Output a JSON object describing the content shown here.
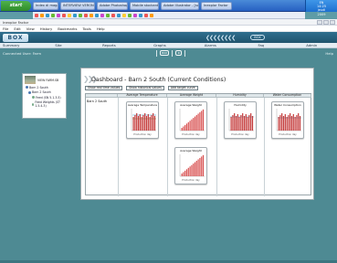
{
  "taskbar": {
    "start_label": "start",
    "tasks": [
      "Index di magazine",
      "INTERVIEW VERONE...",
      "Adobe Photoshop",
      "Mobile stockant",
      "Adobe Illustrator - [scr...",
      "Inexplor Factor"
    ],
    "tray_lines": [
      "EN",
      "14:25",
      "jeudi",
      "2009"
    ]
  },
  "browser": {
    "window_title": "Inexplor Factor",
    "menus": [
      "File",
      "Edit",
      "View",
      "History",
      "Bookmarks",
      "Tools",
      "Help"
    ]
  },
  "app": {
    "logo": "BOX",
    "header_pill": "BOX",
    "nav": [
      "Summary",
      "Site",
      "Reports",
      "Graphs",
      "Alarms",
      "Faq",
      "Admin"
    ],
    "login_text": "Connected User: Farm",
    "help_label": "Help",
    "toolbar": [
      "BOX",
      "⚙"
    ]
  },
  "tree": {
    "site_name": "VIEW FARM.SB",
    "nodes": [
      "Barn 2 South",
      "Barn 2 South",
      "Feed (SN 5.1.3.5)",
      "Feed Weights (ST 1.5.4.3)"
    ]
  },
  "dashboard": {
    "title": "Dashboard - Barn 2 South (Current Conditions)",
    "buttons": [
      "Show real time values",
      "Show historical values",
      "Add target curve"
    ],
    "columns": [
      "Average Temperature",
      "Average Weight",
      "Humidity",
      "Water Consumption"
    ],
    "row_label": "Barn 2 South",
    "widgets": [
      {
        "title": "Average Temperature",
        "footer": "Production day",
        "color": "#c43a3a"
      },
      {
        "title": "Average Weight",
        "footer": "Production day",
        "color": "#d85050"
      },
      {
        "title": "Humidity",
        "footer": "Production day",
        "color": "#c43a3a"
      },
      {
        "title": "Water Consumption",
        "footer": "Production day",
        "color": "#c43a3a"
      },
      {
        "title": "Average Weight",
        "footer": "Production day",
        "color": "#d85050"
      }
    ]
  }
}
